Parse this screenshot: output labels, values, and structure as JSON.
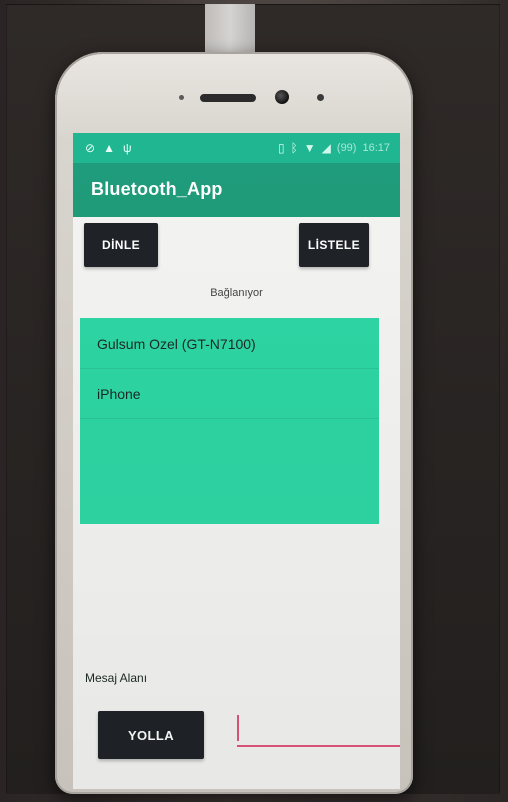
{
  "app": {
    "title": "Bluetooth_App"
  },
  "status_bar": {
    "left_icons": [
      "link-icon",
      "warning-icon",
      "usb-icon"
    ],
    "right_icons": [
      "vibrate-icon",
      "bluetooth-icon",
      "wifi-icon",
      "signal-icon"
    ],
    "battery": "(99)",
    "time": "16:17"
  },
  "buttons": {
    "listen_label": "DİNLE",
    "list_label": "LİSTELE",
    "send_label": "YOLLA"
  },
  "status_text": "Bağlanıyor",
  "device_list": {
    "items": [
      {
        "label": "Gulsum Ozel (GT-N7100)"
      },
      {
        "label": "iPhone"
      }
    ]
  },
  "message_area_label": "Mesaj Alanı",
  "message_input": {
    "value": "",
    "placeholder": ""
  },
  "colors": {
    "status_bar": "#1fb691",
    "app_bar": "#1f9c7b",
    "list_background": "#2ed6a4",
    "button_dark": "#1f2328",
    "input_underline": "#e0567c"
  }
}
